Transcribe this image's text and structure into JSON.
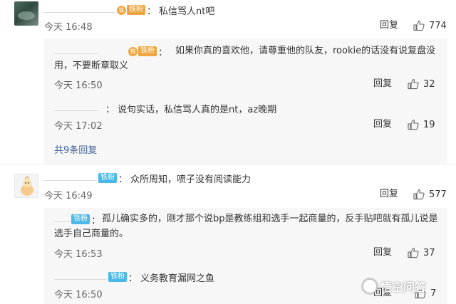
{
  "comments": [
    {
      "badge": "铁粉",
      "text": "私信骂人nt吧",
      "time": "今天 16:48",
      "reply_label": "回复",
      "likes": "774"
    },
    {
      "badge": "铁粉",
      "text": "众所周知，喷子没有阅读能力",
      "time": "今天 16:49",
      "reply_label": "回复",
      "likes": "577"
    }
  ],
  "replies_1": [
    {
      "badge": "铁粉",
      "text": "如果你真的喜欢他，请尊重他的队友，rookie的话没有说复盘没用，不要断章取义",
      "time": "今天 16:50",
      "reply_label": "回复",
      "likes": "32"
    },
    {
      "text": "说句实话，私信骂人真的是nt，az晚期",
      "time": "今天 17:02",
      "reply_label": "回复",
      "likes": "19"
    }
  ],
  "expand_label": "共9条回复",
  "replies_2": [
    {
      "badge": "铁粉",
      "text": "孤儿确实多的，刚才那个说bp是教练组和选手一起商量的，反手贴吧就有孤儿说是选手自己商量的。",
      "time": "今天 16:53",
      "reply_label": "回复",
      "likes": "37"
    },
    {
      "badge": "铁粉",
      "text": "义务教育漏网之鱼",
      "time": "今天 16:50",
      "reply_label": "回复",
      "likes": "7"
    }
  ],
  "colon": "：",
  "badge_dot": "铁",
  "watermark": "悟空问答",
  "colors": {
    "badge_blue": "#49b8e8",
    "badge_orange": "#f0a640",
    "link_blue": "#406599",
    "reply_bg": "#f7f7f7"
  }
}
